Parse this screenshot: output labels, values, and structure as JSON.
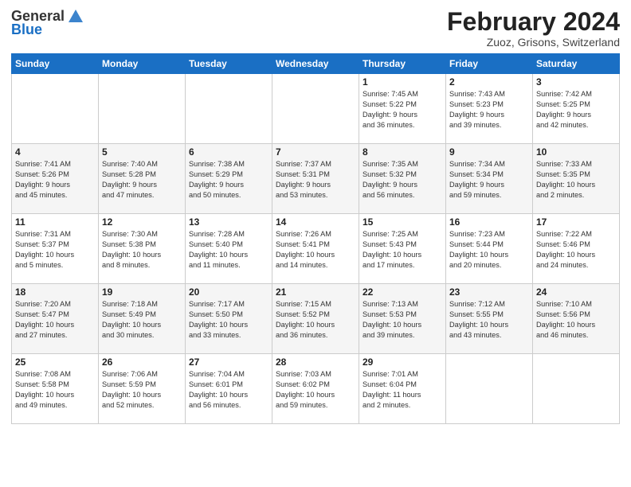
{
  "logo": {
    "general": "General",
    "blue": "Blue"
  },
  "title": "February 2024",
  "subtitle": "Zuoz, Grisons, Switzerland",
  "weekdays": [
    "Sunday",
    "Monday",
    "Tuesday",
    "Wednesday",
    "Thursday",
    "Friday",
    "Saturday"
  ],
  "weeks": [
    [
      {
        "day": "",
        "info": ""
      },
      {
        "day": "",
        "info": ""
      },
      {
        "day": "",
        "info": ""
      },
      {
        "day": "",
        "info": ""
      },
      {
        "day": "1",
        "info": "Sunrise: 7:45 AM\nSunset: 5:22 PM\nDaylight: 9 hours\nand 36 minutes."
      },
      {
        "day": "2",
        "info": "Sunrise: 7:43 AM\nSunset: 5:23 PM\nDaylight: 9 hours\nand 39 minutes."
      },
      {
        "day": "3",
        "info": "Sunrise: 7:42 AM\nSunset: 5:25 PM\nDaylight: 9 hours\nand 42 minutes."
      }
    ],
    [
      {
        "day": "4",
        "info": "Sunrise: 7:41 AM\nSunset: 5:26 PM\nDaylight: 9 hours\nand 45 minutes."
      },
      {
        "day": "5",
        "info": "Sunrise: 7:40 AM\nSunset: 5:28 PM\nDaylight: 9 hours\nand 47 minutes."
      },
      {
        "day": "6",
        "info": "Sunrise: 7:38 AM\nSunset: 5:29 PM\nDaylight: 9 hours\nand 50 minutes."
      },
      {
        "day": "7",
        "info": "Sunrise: 7:37 AM\nSunset: 5:31 PM\nDaylight: 9 hours\nand 53 minutes."
      },
      {
        "day": "8",
        "info": "Sunrise: 7:35 AM\nSunset: 5:32 PM\nDaylight: 9 hours\nand 56 minutes."
      },
      {
        "day": "9",
        "info": "Sunrise: 7:34 AM\nSunset: 5:34 PM\nDaylight: 9 hours\nand 59 minutes."
      },
      {
        "day": "10",
        "info": "Sunrise: 7:33 AM\nSunset: 5:35 PM\nDaylight: 10 hours\nand 2 minutes."
      }
    ],
    [
      {
        "day": "11",
        "info": "Sunrise: 7:31 AM\nSunset: 5:37 PM\nDaylight: 10 hours\nand 5 minutes."
      },
      {
        "day": "12",
        "info": "Sunrise: 7:30 AM\nSunset: 5:38 PM\nDaylight: 10 hours\nand 8 minutes."
      },
      {
        "day": "13",
        "info": "Sunrise: 7:28 AM\nSunset: 5:40 PM\nDaylight: 10 hours\nand 11 minutes."
      },
      {
        "day": "14",
        "info": "Sunrise: 7:26 AM\nSunset: 5:41 PM\nDaylight: 10 hours\nand 14 minutes."
      },
      {
        "day": "15",
        "info": "Sunrise: 7:25 AM\nSunset: 5:43 PM\nDaylight: 10 hours\nand 17 minutes."
      },
      {
        "day": "16",
        "info": "Sunrise: 7:23 AM\nSunset: 5:44 PM\nDaylight: 10 hours\nand 20 minutes."
      },
      {
        "day": "17",
        "info": "Sunrise: 7:22 AM\nSunset: 5:46 PM\nDaylight: 10 hours\nand 24 minutes."
      }
    ],
    [
      {
        "day": "18",
        "info": "Sunrise: 7:20 AM\nSunset: 5:47 PM\nDaylight: 10 hours\nand 27 minutes."
      },
      {
        "day": "19",
        "info": "Sunrise: 7:18 AM\nSunset: 5:49 PM\nDaylight: 10 hours\nand 30 minutes."
      },
      {
        "day": "20",
        "info": "Sunrise: 7:17 AM\nSunset: 5:50 PM\nDaylight: 10 hours\nand 33 minutes."
      },
      {
        "day": "21",
        "info": "Sunrise: 7:15 AM\nSunset: 5:52 PM\nDaylight: 10 hours\nand 36 minutes."
      },
      {
        "day": "22",
        "info": "Sunrise: 7:13 AM\nSunset: 5:53 PM\nDaylight: 10 hours\nand 39 minutes."
      },
      {
        "day": "23",
        "info": "Sunrise: 7:12 AM\nSunset: 5:55 PM\nDaylight: 10 hours\nand 43 minutes."
      },
      {
        "day": "24",
        "info": "Sunrise: 7:10 AM\nSunset: 5:56 PM\nDaylight: 10 hours\nand 46 minutes."
      }
    ],
    [
      {
        "day": "25",
        "info": "Sunrise: 7:08 AM\nSunset: 5:58 PM\nDaylight: 10 hours\nand 49 minutes."
      },
      {
        "day": "26",
        "info": "Sunrise: 7:06 AM\nSunset: 5:59 PM\nDaylight: 10 hours\nand 52 minutes."
      },
      {
        "day": "27",
        "info": "Sunrise: 7:04 AM\nSunset: 6:01 PM\nDaylight: 10 hours\nand 56 minutes."
      },
      {
        "day": "28",
        "info": "Sunrise: 7:03 AM\nSunset: 6:02 PM\nDaylight: 10 hours\nand 59 minutes."
      },
      {
        "day": "29",
        "info": "Sunrise: 7:01 AM\nSunset: 6:04 PM\nDaylight: 11 hours\nand 2 minutes."
      },
      {
        "day": "",
        "info": ""
      },
      {
        "day": "",
        "info": ""
      }
    ]
  ]
}
